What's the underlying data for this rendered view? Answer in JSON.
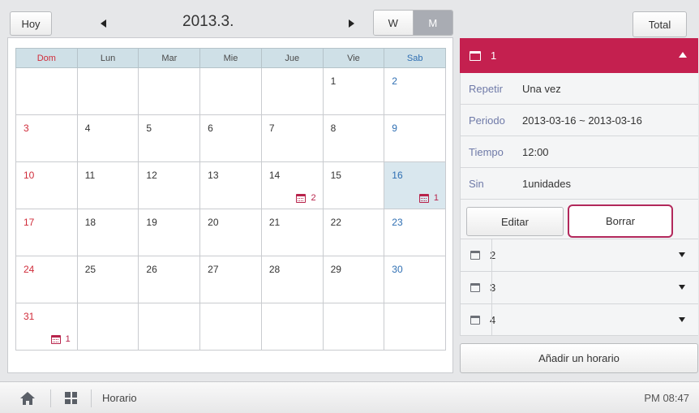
{
  "toolbar": {
    "today_label": "Hoy",
    "month_title": "2013.3.",
    "week_label": "W",
    "month_label": "M",
    "total_label": "Total"
  },
  "calendar": {
    "day_headers": [
      "Dom",
      "Lun",
      "Mar",
      "Mie",
      "Jue",
      "Vie",
      "Sab"
    ],
    "weeks": [
      [
        "",
        "",
        "",
        "",
        "",
        "1",
        "2"
      ],
      [
        "3",
        "4",
        "5",
        "6",
        "7",
        "8",
        "9"
      ],
      [
        "10",
        "11",
        "12",
        "13",
        "14",
        "15",
        "16"
      ],
      [
        "17",
        "18",
        "19",
        "20",
        "21",
        "22",
        "23"
      ],
      [
        "24",
        "25",
        "26",
        "27",
        "28",
        "29",
        "30"
      ],
      [
        "31",
        "",
        "",
        "",
        "",
        "",
        ""
      ]
    ],
    "selected_day": "16",
    "events": {
      "14": "2",
      "16": "1",
      "31": "1"
    },
    "colors": {
      "sunday": "#d02c3a",
      "saturday": "#2f6fb3",
      "event": "#b8234b",
      "selected": "#d9e7ee"
    }
  },
  "detail": {
    "header_label": "1",
    "header_color": "#c4204f",
    "rows": [
      {
        "key": "Repetir",
        "value": "Una vez"
      },
      {
        "key": "Periodo",
        "value": "2013-03-16 ~ 2013-03-16"
      },
      {
        "key": "Tiempo",
        "value": "12:00"
      },
      {
        "key": "Sin",
        "value": "1unidades"
      }
    ],
    "edit_label": "Editar",
    "delete_label": "Borrar"
  },
  "schedules": [
    "2",
    "3",
    "4"
  ],
  "add_label": "Añadir un horario",
  "bottombar": {
    "page_name": "Horario",
    "clock": "PM 08:47"
  },
  "icons": {
    "home": "home-icon",
    "menu": "grid-icon",
    "calendar": "calendar-icon",
    "prev": "triangle-left-icon",
    "next": "triangle-right-icon"
  }
}
